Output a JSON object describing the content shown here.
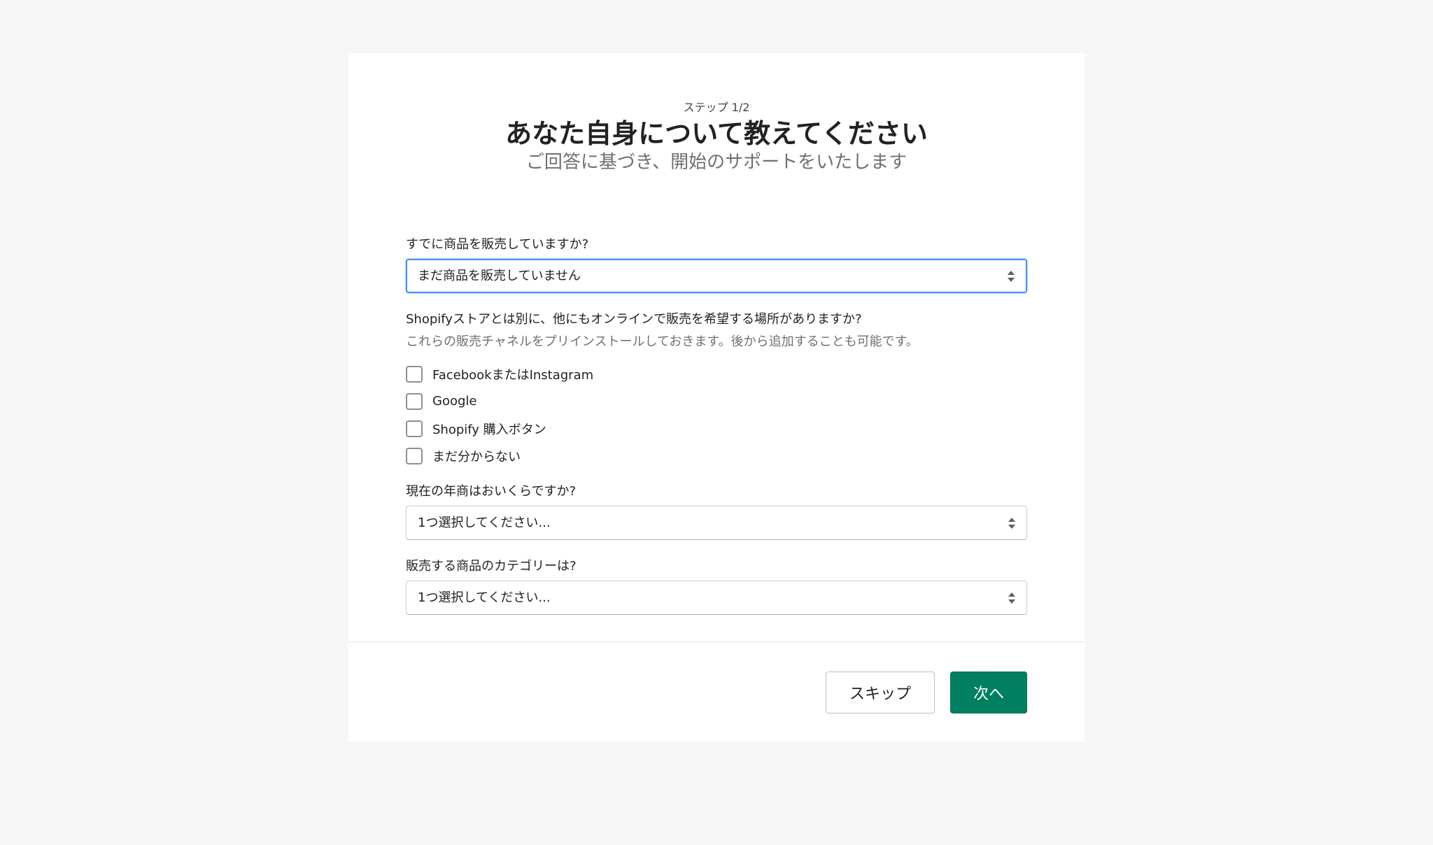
{
  "header": {
    "step": "ステップ 1/2",
    "title": "あなた自身について教えてください",
    "subtitle": "ご回答に基づき、開始のサポートをいたします"
  },
  "questions": {
    "selling": {
      "label": "すでに商品を販売していますか?",
      "value": "まだ商品を販売していません"
    },
    "channels": {
      "label": "Shopifyストアとは別に、他にもオンラインで販売を希望する場所がありますか?",
      "help": "これらの販売チャネルをプリインストールしておきます。後から追加することも可能です。",
      "options": [
        {
          "label": "FacebookまたはInstagram",
          "checked": false
        },
        {
          "label": "Google",
          "checked": false
        },
        {
          "label": "Shopify 購入ボタン",
          "checked": false
        },
        {
          "label": "まだ分からない",
          "checked": false
        }
      ]
    },
    "revenue": {
      "label": "現在の年商はおいくらですか?",
      "value": "1つ選択してください..."
    },
    "category": {
      "label": "販売する商品のカテゴリーは?",
      "value": "1つ選択してください..."
    }
  },
  "footer": {
    "skip_label": "スキップ",
    "next_label": "次へ"
  },
  "colors": {
    "primary": "#008060",
    "focus": "#458fff",
    "background": "#f6f6f7"
  }
}
